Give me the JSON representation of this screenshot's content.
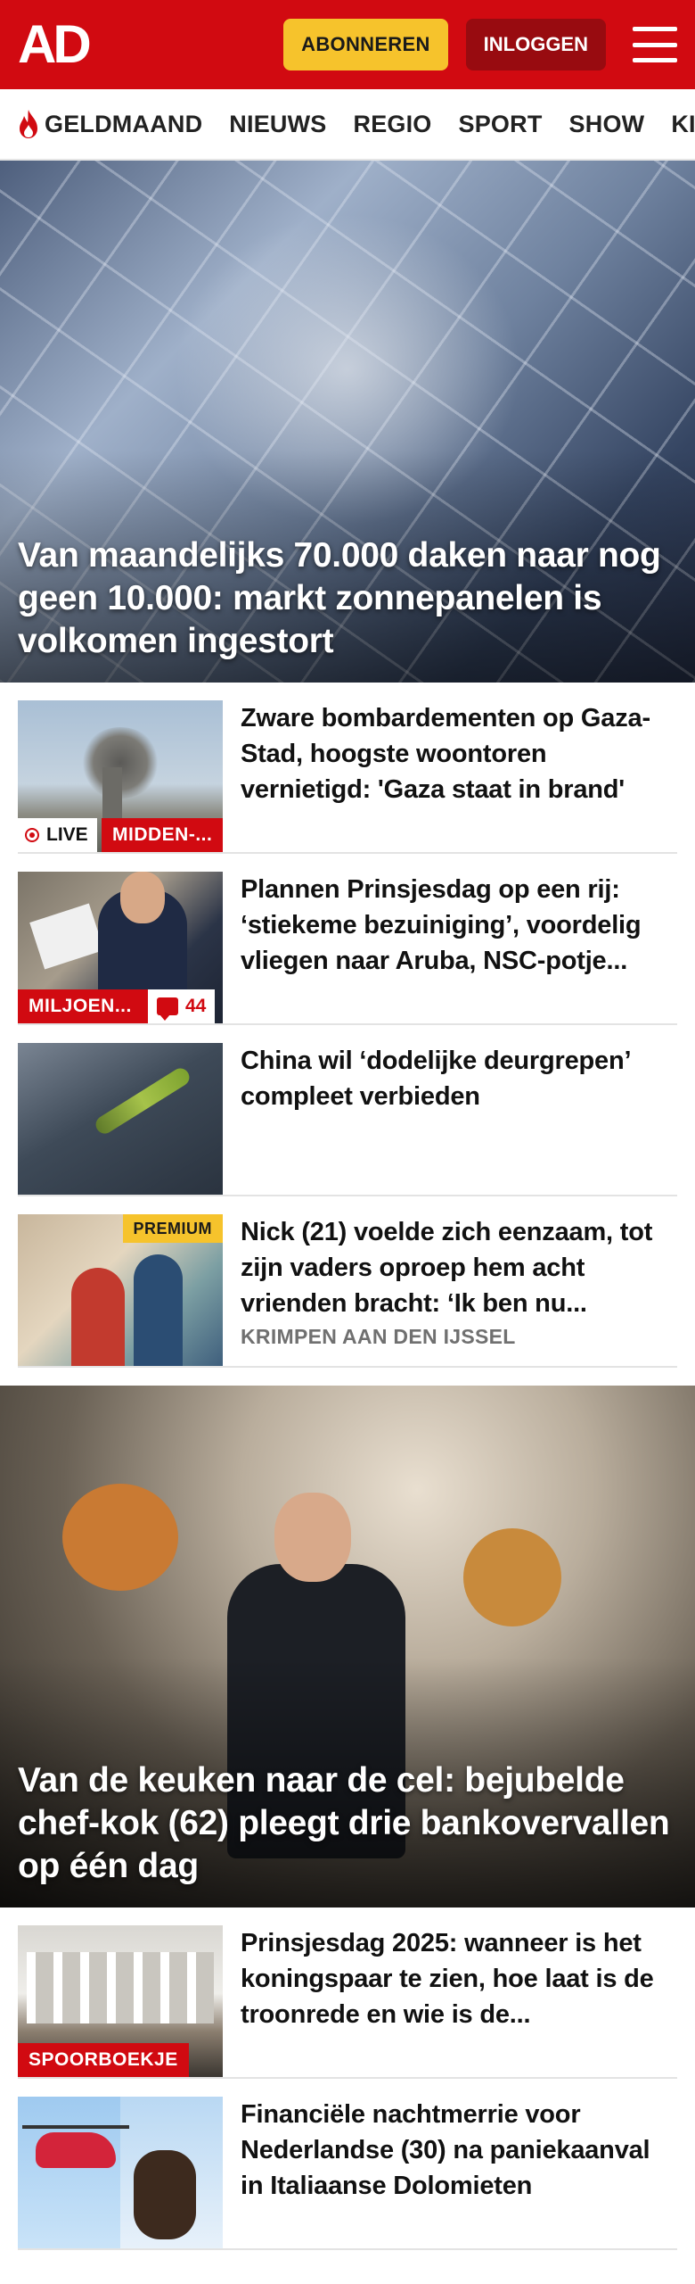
{
  "header": {
    "logo": "AD",
    "subscribe_label": "ABONNEREN",
    "login_label": "INLOGGEN",
    "brand_color": "#d10a11"
  },
  "nav": {
    "items": [
      "GELDMAAND",
      "NIEUWS",
      "REGIO",
      "SPORT",
      "SHOW",
      "KIJK"
    ]
  },
  "hero1": {
    "title": "Van maandelijks 70.000 daken naar nog geen 10.000: markt zonnepanelen is volkomen ingestort"
  },
  "articles_a": [
    {
      "title": "Zware bombardementen op Gaza-Stad, hoogste woontoren vernietigd: 'Gaza staat in brand'",
      "live_label": "LIVE",
      "tag": "MIDDEN-..."
    },
    {
      "title": "Plannen Prinsjesdag op een rij: ‘stiekeme bezuiniging’, voordelig vliegen naar Aruba, NSC-potje...",
      "tag": "MILJOEN...",
      "comments": "44"
    },
    {
      "title": "China wil ‘dodelijke deurgrepen’ compleet verbieden"
    },
    {
      "title": "Nick (21) voelde zich eenzaam, tot zijn vaders oproep hem acht vrienden bracht: ‘Ik ben nu...",
      "badge": "PREMIUM",
      "location": "KRIMPEN AAN DEN IJSSEL"
    }
  ],
  "hero2": {
    "title": "Van de keuken naar de cel: bejubelde chef-kok (62) pleegt drie bankoverval­len op één dag"
  },
  "articles_b": [
    {
      "title": "Prinsjesdag 2025: wanneer is het koningspaar te zien, hoe laat is de troonrede en wie is de...",
      "tag": "SPOORBOEKJE"
    },
    {
      "title": "Financiële nachtmerrie voor Nederlandse (30) na paniekaan­val in Italiaanse Dolomieten"
    }
  ]
}
